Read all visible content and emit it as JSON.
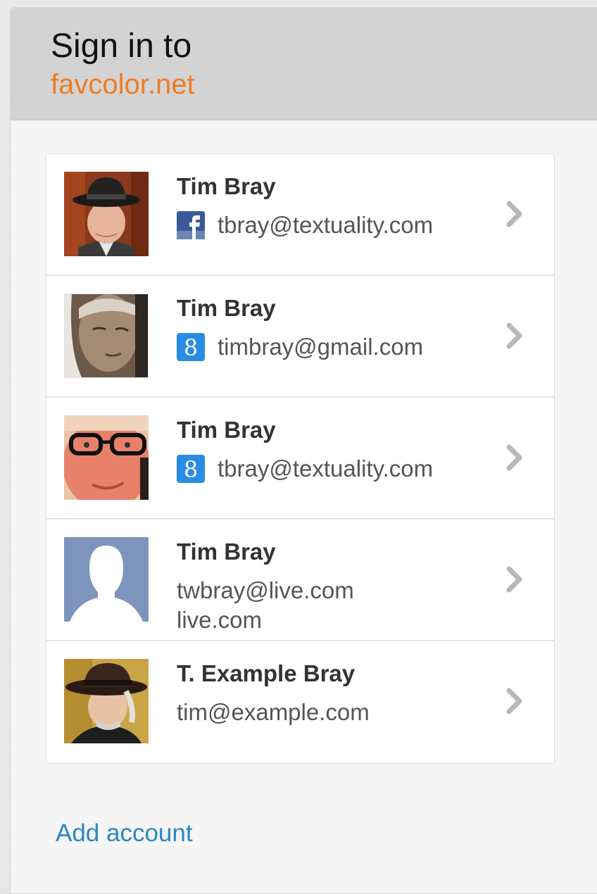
{
  "header": {
    "title": "Sign in to",
    "site": "favcolor.net"
  },
  "accounts": [
    {
      "name": "Tim Bray",
      "email": "tbray@textuality.com",
      "provider": "facebook",
      "provider_icon": "facebook-icon"
    },
    {
      "name": "Tim Bray",
      "email": "timbray@gmail.com",
      "provider": "google",
      "provider_icon": "google-icon"
    },
    {
      "name": "Tim Bray",
      "email": "tbray@textuality.com",
      "provider": "google",
      "provider_icon": "google-icon"
    },
    {
      "name": "Tim Bray",
      "email": "twbray@live.com",
      "provider_text": "live.com",
      "provider_icon": "none"
    },
    {
      "name": "T. Example Bray",
      "email": "tim@example.com",
      "provider_icon": "none"
    }
  ],
  "footer": {
    "add_account": "Add account"
  },
  "colors": {
    "site_accent": "#f07b22",
    "link": "#2d86c4",
    "facebook": "#3b5998",
    "google": "#2a8de3"
  }
}
